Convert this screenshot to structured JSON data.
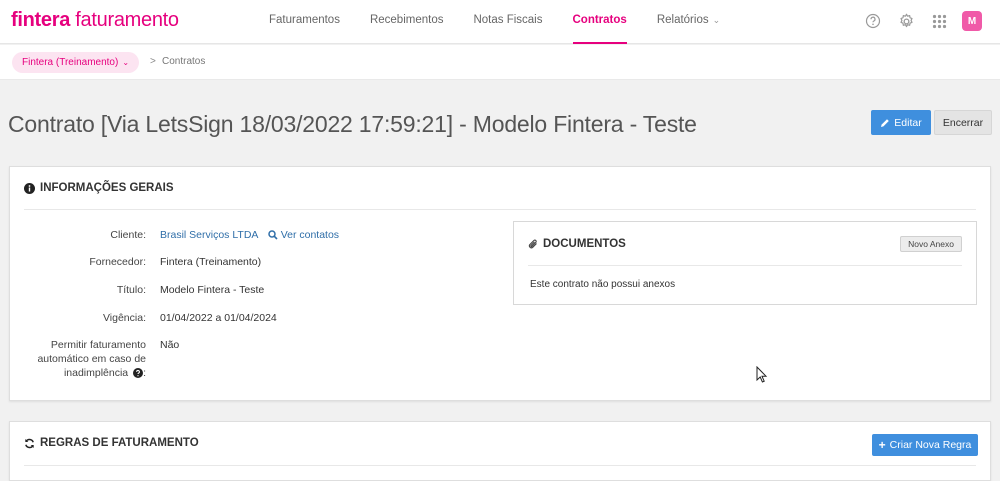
{
  "header": {
    "brand": "fintera",
    "product": "faturamento",
    "nav": [
      {
        "label": "Faturamentos"
      },
      {
        "label": "Recebimentos"
      },
      {
        "label": "Notas Fiscais"
      },
      {
        "label": "Contratos"
      },
      {
        "label": "Relatórios"
      }
    ],
    "avatar_initial": "M",
    "icons": [
      "help-circle-icon",
      "gear-icon",
      "apps-grid-icon"
    ]
  },
  "breadcrumb": {
    "account": "Fintera (Treinamento)",
    "separator": ">",
    "current": "Contratos"
  },
  "page": {
    "title": "Contrato [Via LetsSign 18/03/2022 17:59:21] - Modelo Fintera - Teste",
    "edit_label": "Editar",
    "close_label": "Encerrar"
  },
  "info": {
    "heading": "INFORMAÇÕES GERAIS",
    "fields": [
      {
        "label": "Cliente:",
        "value": "Brasil Serviços LTDA",
        "link": "Ver contatos"
      },
      {
        "label": "Fornecedor:",
        "value": "Fintera (Treinamento)"
      },
      {
        "label": "Título:",
        "value": "Modelo Fintera - Teste"
      },
      {
        "label": "Vigência:",
        "value": "01/04/2022 a 01/04/2024"
      },
      {
        "label_lines": [
          "Permitir faturamento",
          "automático em caso de",
          "inadimplência"
        ],
        "label_suffix": ":",
        "value": "Não"
      }
    ]
  },
  "documents": {
    "heading": "DOCUMENTOS",
    "new_label": "Novo Anexo",
    "empty_text": "Este contrato não possui anexos"
  },
  "rules": {
    "heading": "REGRAS DE FATURAMENTO",
    "create_label": "Criar Nova Regra"
  },
  "colors": {
    "brand": "#e6007e",
    "primary_button": "#3f8fde",
    "link": "#2f6ea8"
  }
}
